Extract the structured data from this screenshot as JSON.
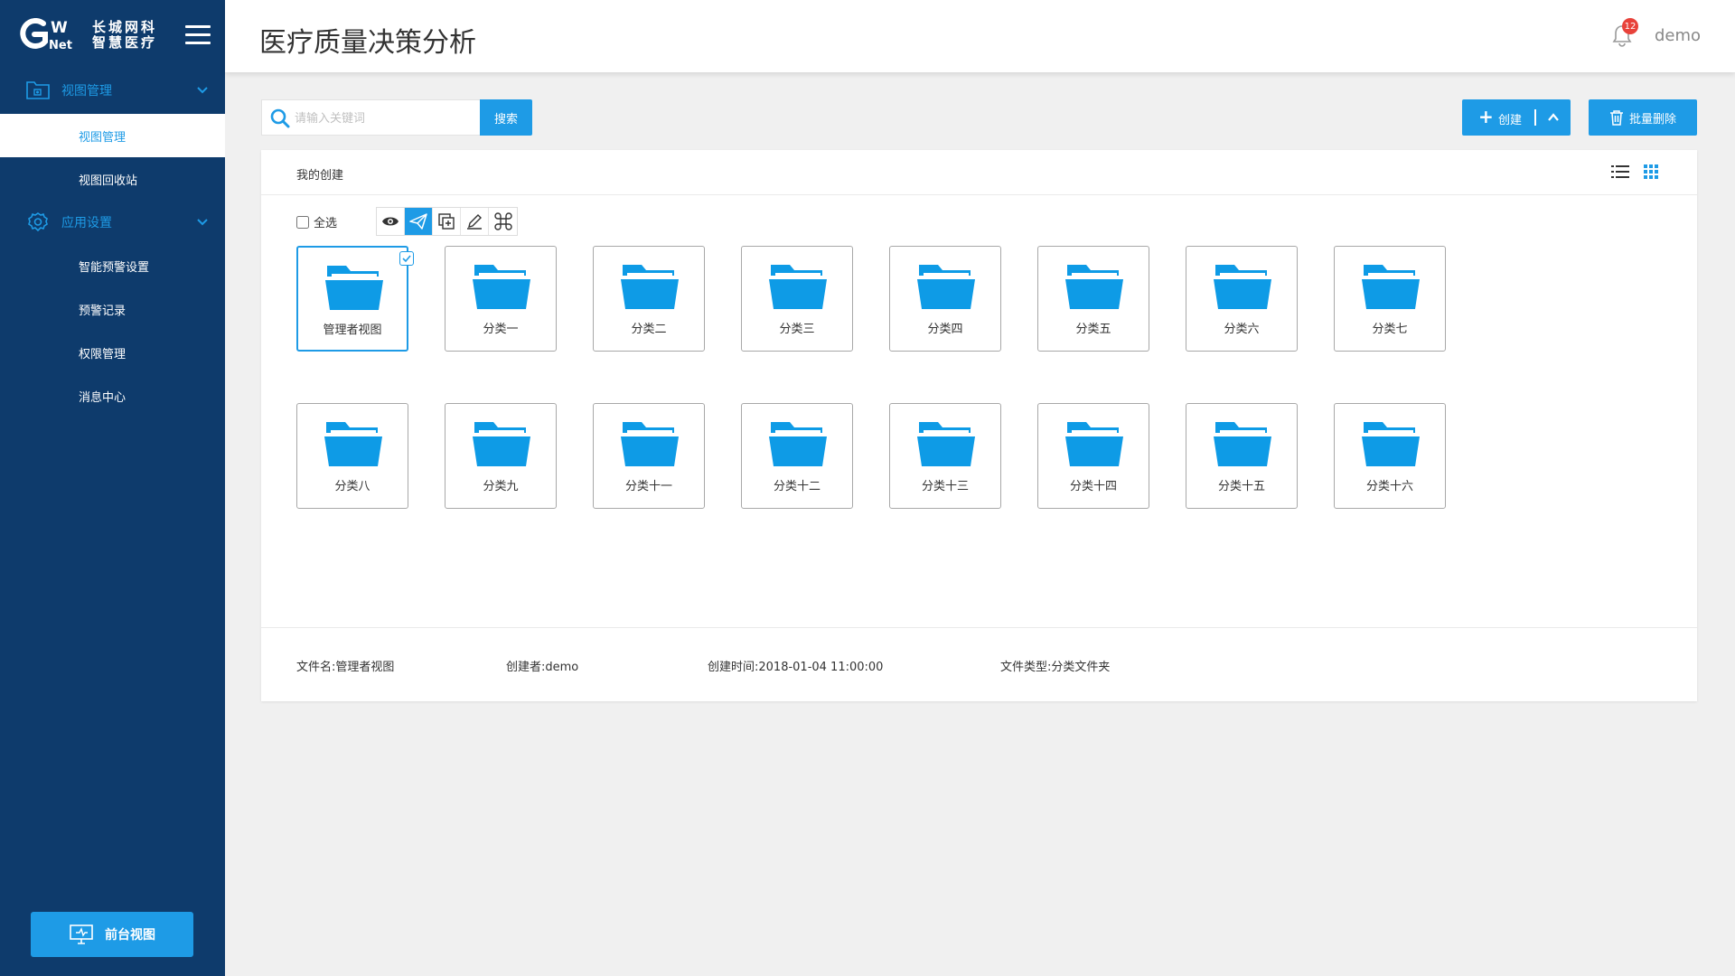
{
  "brand": {
    "logo_letters": "GW",
    "logo_net": "Net",
    "line1": "长城网科",
    "line2": "智慧医疗"
  },
  "sidebar": {
    "groups": [
      {
        "label": "视图管理",
        "items": [
          {
            "label": "视图管理",
            "active": true
          },
          {
            "label": "视图回收站",
            "active": false
          }
        ]
      },
      {
        "label": "应用设置",
        "items": [
          {
            "label": "智能预警设置",
            "active": false
          },
          {
            "label": "预警记录",
            "active": false
          },
          {
            "label": "权限管理",
            "active": false
          },
          {
            "label": "消息中心",
            "active": false
          }
        ]
      }
    ],
    "front_view_label": "前台视图"
  },
  "header": {
    "title": "医疗质量决策分析",
    "notification_count": "12",
    "user": "demo"
  },
  "search": {
    "placeholder": "请输入关键词",
    "value": "",
    "button": "搜索"
  },
  "actions": {
    "create": "创建",
    "batch_delete": "批量删除"
  },
  "panel": {
    "title": "我的创建",
    "select_all": "全选",
    "folders": [
      "管理者视图",
      "分类一",
      "分类二",
      "分类三",
      "分类四",
      "分类五",
      "分类六",
      "分类七",
      "分类八",
      "分类九",
      "分类十一",
      "分类十二",
      "分类十三",
      "分类十四",
      "分类十五",
      "分类十六"
    ],
    "selected_folder": "管理者视图"
  },
  "info": {
    "file_name": "文件名:管理者视图",
    "creator": "创建者:demo",
    "created_time": "创建时间:2018-01-04 11:00:00",
    "file_type": "文件类型:分类文件夹"
  },
  "colors": {
    "sidebar": "#0e3b6c",
    "accent": "#1e9be6",
    "folder": "#0e9be6",
    "badge": "#e8423a"
  }
}
